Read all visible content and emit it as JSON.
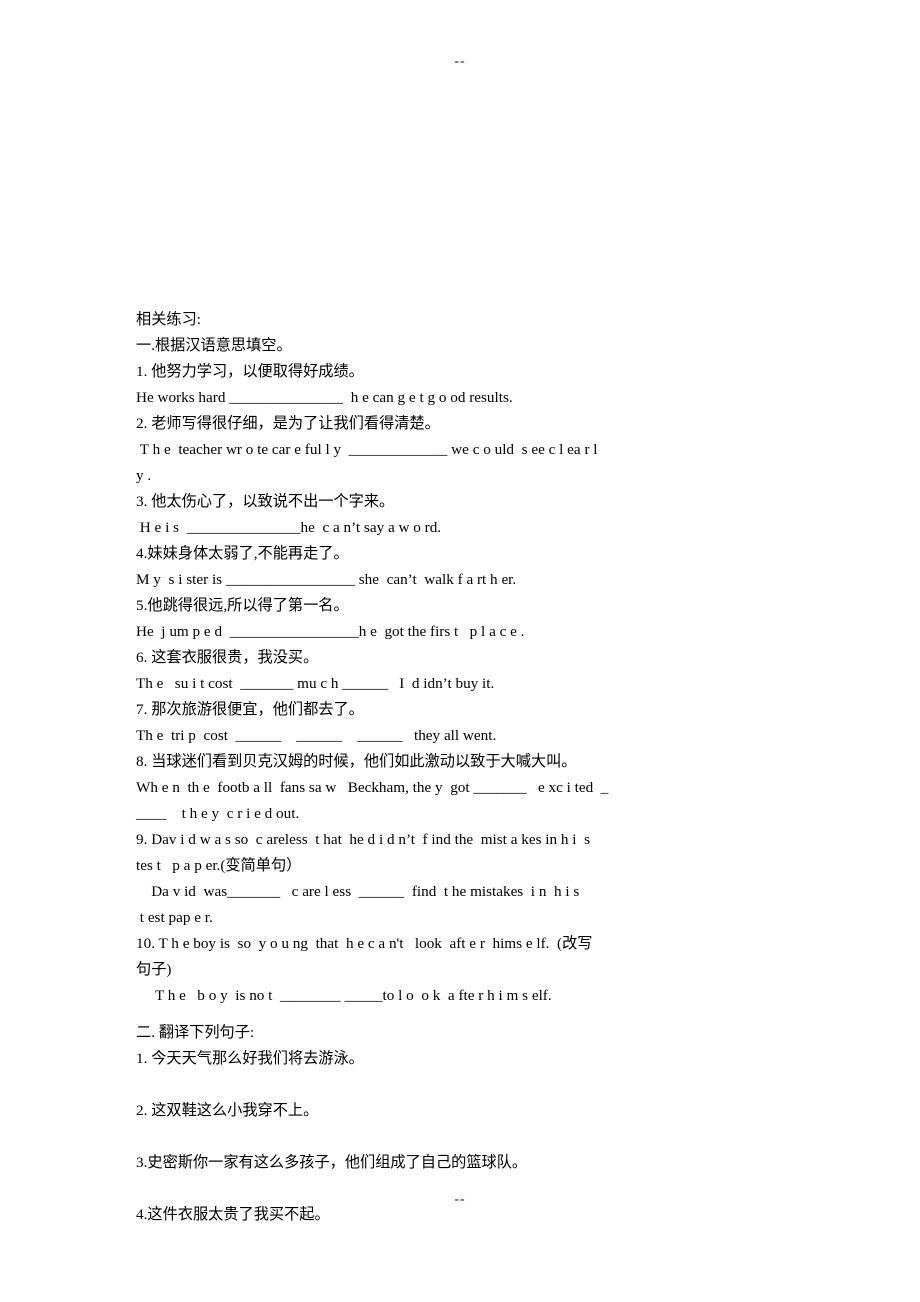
{
  "page": {
    "header_mark": "--",
    "footer_mark": "--"
  },
  "document": {
    "intro_heading": "相关练习:",
    "section_one": {
      "heading": "一.根据汉语意思填空。",
      "items": [
        {
          "number": "1.",
          "prompt_zh": "1. 他努力学习，以便取得好成绩。",
          "answer_lines": [
            "He works hard _______________  h e can g e t g o od results."
          ]
        },
        {
          "number": "2.",
          "prompt_zh": "2. 老师写得很仔细，是为了让我们看得清楚。",
          "answer_lines": [
            " T h e  teacher wr o te car e ful l y  _____________ we c o uld  s ee c l ea r l",
            "y ."
          ]
        },
        {
          "number": "3.",
          "prompt_zh": "3. 他太伤心了，以致说不出一个字来。",
          "answer_lines": [
            " H e i s  _______________he  c a n’t say a w o rd."
          ]
        },
        {
          "number": "4.",
          "prompt_zh": "4.妹妹身体太弱了,不能再走了。",
          "answer_lines": [
            "M y  s i ster is _________________ she  can’t  walk f a rt h er."
          ]
        },
        {
          "number": "5.",
          "prompt_zh": "5.他跳得很远,所以得了第一名。",
          "answer_lines": [
            "He  j um p e d  _________________h e  got the firs t   p l a c e ."
          ]
        },
        {
          "number": "6.",
          "prompt_zh": "6. 这套衣服很贵，我没买。",
          "answer_lines": [
            "Th e   su i t cost  _______ mu c h ______   I  d idn’t buy it."
          ]
        },
        {
          "number": "7.",
          "prompt_zh": "7. 那次旅游很便宜，他们都去了。",
          "answer_lines": [
            "Th e  tri p  cost  ______    ______    ______   they all went."
          ]
        },
        {
          "number": "8.",
          "prompt_zh": "8. 当球迷们看到贝克汉姆的时候，他们如此激动以致于大喊大叫。",
          "answer_lines": [
            "Wh e n  th e  footb a ll  fans sa w   Beckham, the y  got _______   e xc i ted  _",
            "____    t h e y  c r i e d out."
          ]
        },
        {
          "number": "9.",
          "prompt_zh": "9. Dav i d w a s so  c areless  t hat  he d i d n’t  f ind the  mist a kes in h i  s",
          "prompt_zh_cont": "tes t   p a p er.(变简单句）",
          "answer_lines": [
            "    Da v id  was_______   c are l ess  ______  find  t he mistakes  i n  h i s",
            " t est pap e r."
          ]
        },
        {
          "number": "10.",
          "prompt_zh": "10. T h e boy is  so  y o u ng  that  h e c a n't   look  aft e r  hims e lf.  (改写",
          "prompt_zh_cont": "句子)",
          "answer_lines": [
            "     T h e   b o y  is no t  ________ _____to l o  o k  a fte r h i m s elf."
          ]
        }
      ]
    },
    "section_two": {
      "heading": "二. 翻译下列句子:",
      "items": [
        {
          "number": "1.",
          "prompt_zh": "1. 今天天气那么好我们将去游泳。"
        },
        {
          "number": "2.",
          "prompt_zh": "2. 这双鞋这么小我穿不上。"
        },
        {
          "number": "3.",
          "prompt_zh": "3.史密斯你一家有这么多孩子，他们组成了自己的篮球队。"
        },
        {
          "number": "4.",
          "prompt_zh": "4.这件衣服太贵了我买不起。"
        }
      ]
    }
  }
}
